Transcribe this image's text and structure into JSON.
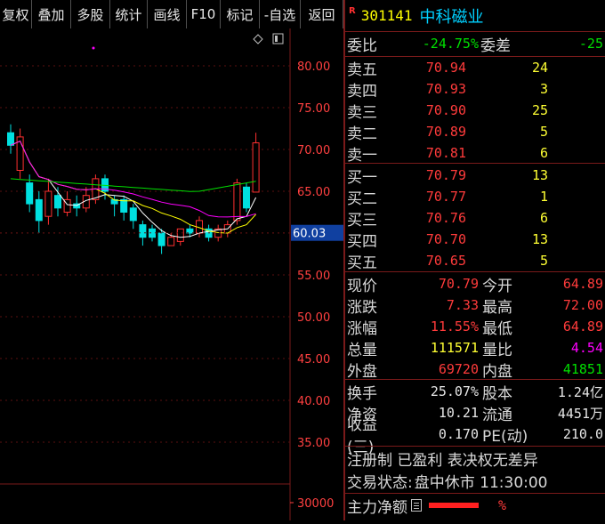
{
  "toolbar": {
    "items": [
      "复权",
      "叠加",
      "多股",
      "统计",
      "画线",
      "F10",
      "标记",
      "-自选",
      "返回"
    ]
  },
  "chart": {
    "price_axis": [
      "80.00",
      "75.00",
      "70.00",
      "65.00",
      "60.00",
      "55.00",
      "50.00",
      "45.00",
      "40.00",
      "35.00"
    ],
    "volume_axis": "30000",
    "cursor_price": "60.03",
    "candles": [
      {
        "o": 72.0,
        "c": 70.5,
        "h": 73.0,
        "l": 69.5
      },
      {
        "o": 67.5,
        "c": 71.5,
        "h": 72.5,
        "l": 66.5
      },
      {
        "o": 66.0,
        "c": 63.5,
        "h": 67.0,
        "l": 62.5
      },
      {
        "o": 64.0,
        "c": 61.5,
        "h": 65.0,
        "l": 60.0
      },
      {
        "o": 62.0,
        "c": 65.0,
        "h": 66.5,
        "l": 61.0
      },
      {
        "o": 64.5,
        "c": 63.0,
        "h": 65.5,
        "l": 62.0
      },
      {
        "o": 62.5,
        "c": 64.0,
        "h": 65.0,
        "l": 62.0
      },
      {
        "o": 63.5,
        "c": 63.0,
        "h": 64.5,
        "l": 62.0
      },
      {
        "o": 63.0,
        "c": 64.5,
        "h": 65.5,
        "l": 62.5
      },
      {
        "o": 64.0,
        "c": 66.5,
        "h": 67.0,
        "l": 63.5
      },
      {
        "o": 66.5,
        "c": 65.0,
        "h": 67.0,
        "l": 64.0
      },
      {
        "o": 64.0,
        "c": 63.5,
        "h": 64.5,
        "l": 62.0
      },
      {
        "o": 64.0,
        "c": 62.5,
        "h": 64.5,
        "l": 61.5
      },
      {
        "o": 63.0,
        "c": 61.5,
        "h": 63.5,
        "l": 60.5
      },
      {
        "o": 61.0,
        "c": 59.5,
        "h": 61.5,
        "l": 58.5
      },
      {
        "o": 60.5,
        "c": 59.5,
        "h": 61.0,
        "l": 59.0
      },
      {
        "o": 60.0,
        "c": 58.5,
        "h": 60.5,
        "l": 57.5
      },
      {
        "o": 58.5,
        "c": 59.5,
        "h": 60.0,
        "l": 58.5
      },
      {
        "o": 59.0,
        "c": 60.5,
        "h": 60.5,
        "l": 58.5
      },
      {
        "o": 60.5,
        "c": 60.0,
        "h": 61.0,
        "l": 59.5
      },
      {
        "o": 60.0,
        "c": 61.5,
        "h": 62.0,
        "l": 59.5
      },
      {
        "o": 60.5,
        "c": 59.5,
        "h": 61.0,
        "l": 59.0
      },
      {
        "o": 59.5,
        "c": 60.5,
        "h": 61.0,
        "l": 59.0
      },
      {
        "o": 60.0,
        "c": 61.0,
        "h": 61.5,
        "l": 59.5
      },
      {
        "o": 61.5,
        "c": 66.0,
        "h": 66.5,
        "l": 61.0
      },
      {
        "o": 65.5,
        "c": 63.0,
        "h": 66.0,
        "l": 62.5
      },
      {
        "o": 64.9,
        "c": 70.79,
        "h": 72.0,
        "l": 64.89
      }
    ]
  },
  "quote": {
    "r_badge": "R",
    "code": "301141",
    "name": "中科磁业",
    "weibi_label": "委比",
    "weibi_value": "-24.75%",
    "weicha_label": "委差",
    "weicha_value": "-25",
    "asks": [
      {
        "label": "卖五",
        "price": "70.94",
        "vol": "24"
      },
      {
        "label": "卖四",
        "price": "70.93",
        "vol": "3"
      },
      {
        "label": "卖三",
        "price": "70.90",
        "vol": "25"
      },
      {
        "label": "卖二",
        "price": "70.89",
        "vol": "5"
      },
      {
        "label": "卖一",
        "price": "70.81",
        "vol": "6"
      }
    ],
    "bids": [
      {
        "label": "买一",
        "price": "70.79",
        "vol": "13"
      },
      {
        "label": "买二",
        "price": "70.77",
        "vol": "1"
      },
      {
        "label": "买三",
        "price": "70.76",
        "vol": "6"
      },
      {
        "label": "买四",
        "price": "70.70",
        "vol": "13"
      },
      {
        "label": "买五",
        "price": "70.65",
        "vol": "5"
      }
    ],
    "stats": [
      {
        "l1": "现价",
        "v1": "70.79",
        "l2": "今开",
        "v2": "64.89"
      },
      {
        "l1": "涨跌",
        "v1": "7.33",
        "l2": "最高",
        "v2": "72.00"
      },
      {
        "l1": "涨幅",
        "v1": "11.55%",
        "l2": "最低",
        "v2": "64.89"
      },
      {
        "l1": "总量",
        "v1": "111571",
        "l2": "量比",
        "v2": "4.54"
      },
      {
        "l1": "外盘",
        "v1": "69720",
        "l2": "内盘",
        "v2": "41851"
      }
    ],
    "finance": [
      {
        "l1": "换手",
        "v1": "25.07%",
        "l2": "股本",
        "v2": "1.24亿"
      },
      {
        "l1": "净资",
        "v1": "10.21",
        "l2": "流通",
        "v2": "4451万"
      },
      {
        "l1": "收益(三)",
        "v1": "0.170",
        "l2": "PE(动)",
        "v2": "210.0"
      }
    ],
    "tags": "注册制 已盈利 表决权无差异",
    "trade_status_label": "交易状态:",
    "trade_status_value": "盘中休市 11:30:00",
    "main_net_label": "主力净额",
    "main_net_value": "%"
  }
}
